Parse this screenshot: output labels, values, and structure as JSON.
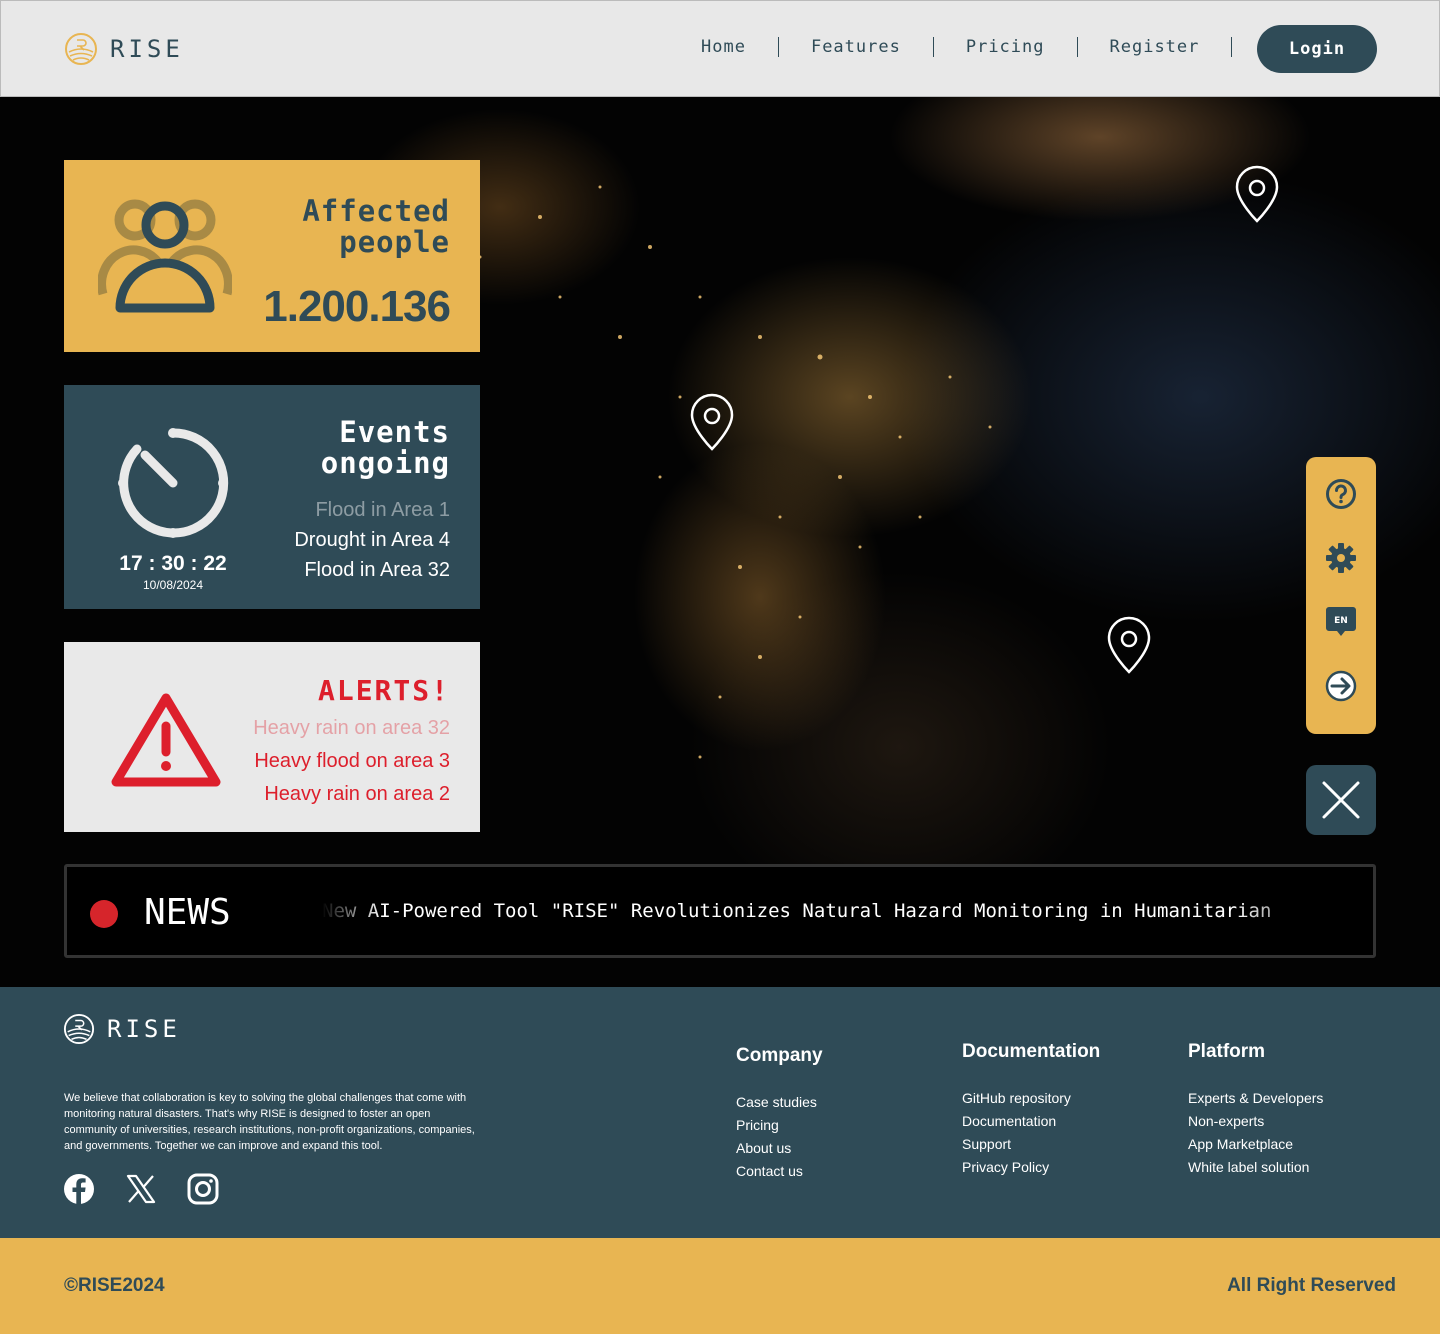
{
  "header": {
    "logo_text": "RISE",
    "nav": [
      "Home",
      "Features",
      "Pricing",
      "Register"
    ],
    "login_label": "Login"
  },
  "map": {
    "pins": [
      "map-pin-icon",
      "map-pin-icon",
      "map-pin-icon"
    ]
  },
  "affected": {
    "title_line1": "Affected",
    "title_line2": "people",
    "count": "1.200.136",
    "icon": "people-group-icon"
  },
  "events": {
    "title_line1": "Events",
    "title_line2": "ongoing",
    "items": [
      "Flood in Area 1",
      "Drought in Area 4",
      "Flood in Area 32"
    ],
    "time": "17 : 30 : 22",
    "date": "10/08/2024",
    "icon": "clock-icon"
  },
  "alerts": {
    "title": "ALERTS!",
    "items": [
      "Heavy rain on area 32",
      "Heavy flood on area 3",
      "Heavy rain on area 2"
    ],
    "icon": "warning-icon",
    "color": "#dd1f2c"
  },
  "toolbar": {
    "icons": [
      "help-icon",
      "settings-gear-icon",
      "language-icon",
      "logout-arrow-icon"
    ],
    "language_code": "EN"
  },
  "news": {
    "label": "NEWS",
    "headline": "New AI-Powered Tool \"RISE\" Revolutionizes Natural Hazard Monitoring in Humanitarian"
  },
  "footer": {
    "logo_text": "RISE",
    "about": "We believe that collaboration is key to solving the global challenges that come with monitoring natural disasters. That's why RISE is designed to foster an open community of universities, research institutions, non-profit organizations, companies, and governments. Together we can improve and expand this tool.",
    "socials": [
      "facebook-icon",
      "x-icon",
      "instagram-icon"
    ],
    "columns": [
      {
        "title": "Company",
        "links": [
          "Case studies",
          "Pricing",
          "About us",
          "Contact us"
        ]
      },
      {
        "title": "Documentation",
        "links": [
          "GitHub repository",
          "Documentation",
          "Support",
          "Privacy Policy"
        ]
      },
      {
        "title": "Platform",
        "links": [
          "Experts & Developers",
          "Non-experts",
          "App Marketplace",
          "White label solution"
        ]
      }
    ],
    "copyright": "©RISE2024",
    "rights": "All Right Reserved"
  },
  "colors": {
    "yellow": "#e8b552",
    "teal": "#2f4b57",
    "red": "#dd1f2c",
    "light": "#e8e8e8"
  }
}
